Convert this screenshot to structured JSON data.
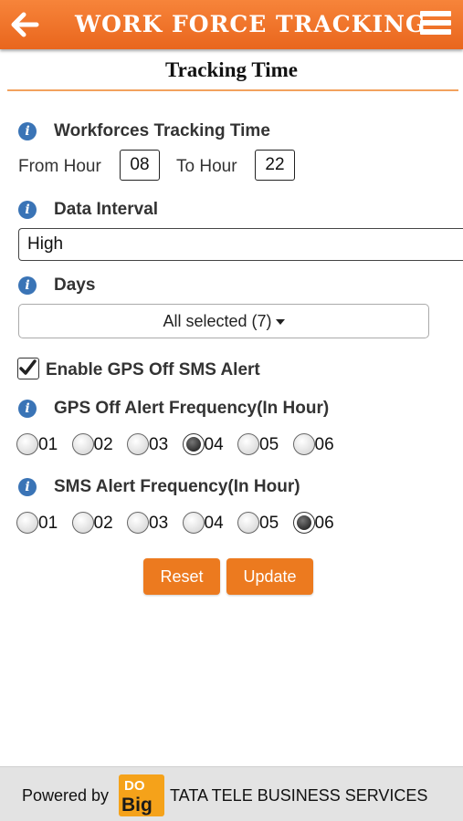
{
  "header": {
    "title": "WORK FORCE TRACKING",
    "back_icon": "arrow-left-icon",
    "menu_icon": "hamburger-menu-icon",
    "color": "#ef7127"
  },
  "page": {
    "title": "Tracking Time"
  },
  "tracking_time": {
    "label": "Workforces Tracking Time",
    "from_label": "From Hour",
    "from_value": "08",
    "to_label": "To Hour",
    "to_value": "22"
  },
  "data_interval": {
    "label": "Data Interval",
    "selected": "High"
  },
  "days": {
    "label": "Days",
    "selected": "All selected (7)"
  },
  "gps_sms_alert": {
    "label": "Enable GPS Off SMS Alert",
    "checked": true
  },
  "gps_off_frequency": {
    "label": "GPS Off Alert Frequency(In Hour)",
    "options": [
      "01",
      "02",
      "03",
      "04",
      "05",
      "06"
    ],
    "selected": "04"
  },
  "sms_frequency": {
    "label": "SMS Alert Frequency(In Hour)",
    "options": [
      "01",
      "02",
      "03",
      "04",
      "05",
      "06"
    ],
    "selected": "06"
  },
  "actions": {
    "reset_label": "Reset",
    "update_label": "Update",
    "button_color": "#ec7a1f"
  },
  "footer": {
    "powered_by": "Powered by",
    "logo_text_top": "DO",
    "logo_text_bottom": "Big",
    "company": "TATA TELE BUSINESS SERVICES"
  }
}
